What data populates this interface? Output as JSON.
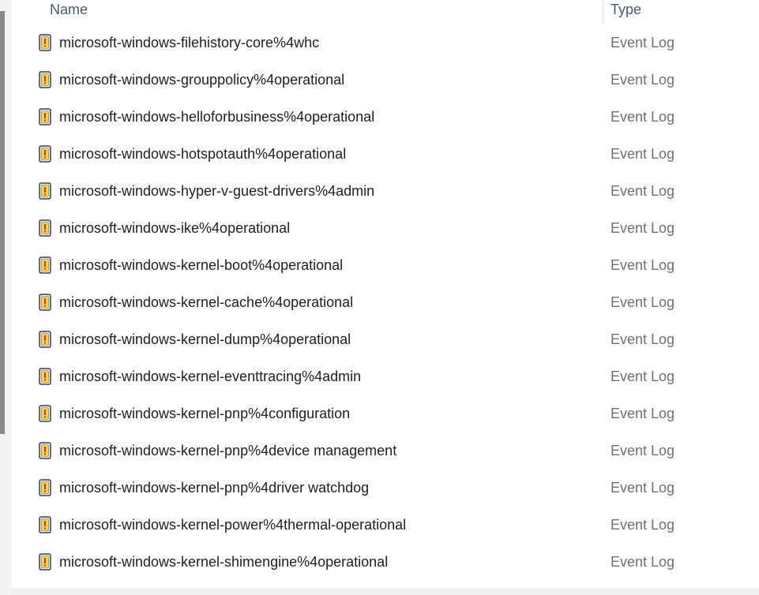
{
  "columns": {
    "name": "Name",
    "type": "Type"
  },
  "rows": [
    {
      "name": "microsoft-windows-filehistory-core%4whc",
      "type": "Event Log",
      "icon": "event-log-file-icon"
    },
    {
      "name": "microsoft-windows-grouppolicy%4operational",
      "type": "Event Log",
      "icon": "event-log-file-icon"
    },
    {
      "name": "microsoft-windows-helloforbusiness%4operational",
      "type": "Event Log",
      "icon": "event-log-file-icon"
    },
    {
      "name": "microsoft-windows-hotspotauth%4operational",
      "type": "Event Log",
      "icon": "event-log-file-icon"
    },
    {
      "name": "microsoft-windows-hyper-v-guest-drivers%4admin",
      "type": "Event Log",
      "icon": "event-log-file-icon"
    },
    {
      "name": "microsoft-windows-ike%4operational",
      "type": "Event Log",
      "icon": "event-log-file-icon"
    },
    {
      "name": "microsoft-windows-kernel-boot%4operational",
      "type": "Event Log",
      "icon": "event-log-file-icon"
    },
    {
      "name": "microsoft-windows-kernel-cache%4operational",
      "type": "Event Log",
      "icon": "event-log-file-icon"
    },
    {
      "name": "microsoft-windows-kernel-dump%4operational",
      "type": "Event Log",
      "icon": "event-log-file-icon"
    },
    {
      "name": "microsoft-windows-kernel-eventtracing%4admin",
      "type": "Event Log",
      "icon": "event-log-file-icon"
    },
    {
      "name": "microsoft-windows-kernel-pnp%4configuration",
      "type": "Event Log",
      "icon": "event-log-file-icon"
    },
    {
      "name": "microsoft-windows-kernel-pnp%4device management",
      "type": "Event Log",
      "icon": "event-log-file-icon"
    },
    {
      "name": "microsoft-windows-kernel-pnp%4driver watchdog",
      "type": "Event Log",
      "icon": "event-log-file-icon"
    },
    {
      "name": "microsoft-windows-kernel-power%4thermal-operational",
      "type": "Event Log",
      "icon": "event-log-file-icon"
    },
    {
      "name": "microsoft-windows-kernel-shimengine%4operational",
      "type": "Event Log",
      "icon": "event-log-file-icon"
    }
  ],
  "colors": {
    "header_text": "#4a5a75",
    "name_text": "#1f1f1f",
    "type_text": "#707070"
  }
}
